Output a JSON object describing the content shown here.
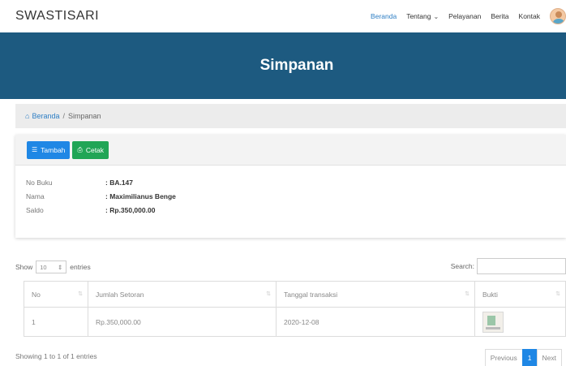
{
  "brand": "SWASTISARI",
  "nav": {
    "items": [
      {
        "label": "Beranda",
        "active": true
      },
      {
        "label": "Tentang",
        "dropdown": true
      },
      {
        "label": "Pelayanan"
      },
      {
        "label": "Berita"
      },
      {
        "label": "Kontak"
      }
    ]
  },
  "banner": {
    "title": "Simpanan"
  },
  "breadcrumb": {
    "home": "Beranda",
    "separator": "/",
    "current": "Simpanan"
  },
  "actions": {
    "add_label": "Tambah",
    "print_label": "Cetak"
  },
  "account": {
    "rows": [
      {
        "key": "No Buku",
        "value": ": BA.147"
      },
      {
        "key": "Nama",
        "value": ": Maximilianus Benge"
      },
      {
        "key": "Saldo",
        "value": ": Rp.350,000.00"
      }
    ]
  },
  "table_controls": {
    "show_label": "Show",
    "entries_value": "10",
    "entries_label": "entries",
    "search_label": "Search:",
    "search_placeholder": ""
  },
  "table": {
    "columns": [
      "No",
      "Jumlah Setoran",
      "Tanggal transaksi",
      "Bukti"
    ],
    "rows": [
      {
        "no": "1",
        "amount": "Rp.350,000.00",
        "date": "2020-12-08"
      }
    ]
  },
  "footer": {
    "info": "Showing 1 to 1 of 1 entries",
    "previous": "Previous",
    "page": "1",
    "next": "Next"
  },
  "colors": {
    "accent": "#1d5a80",
    "primary": "#1f87e5",
    "success": "#21a556",
    "link": "#2d7ec4"
  },
  "icons": {
    "home": "home-icon",
    "add": "list-icon",
    "print": "printer-icon",
    "sort": "sort-icon"
  }
}
